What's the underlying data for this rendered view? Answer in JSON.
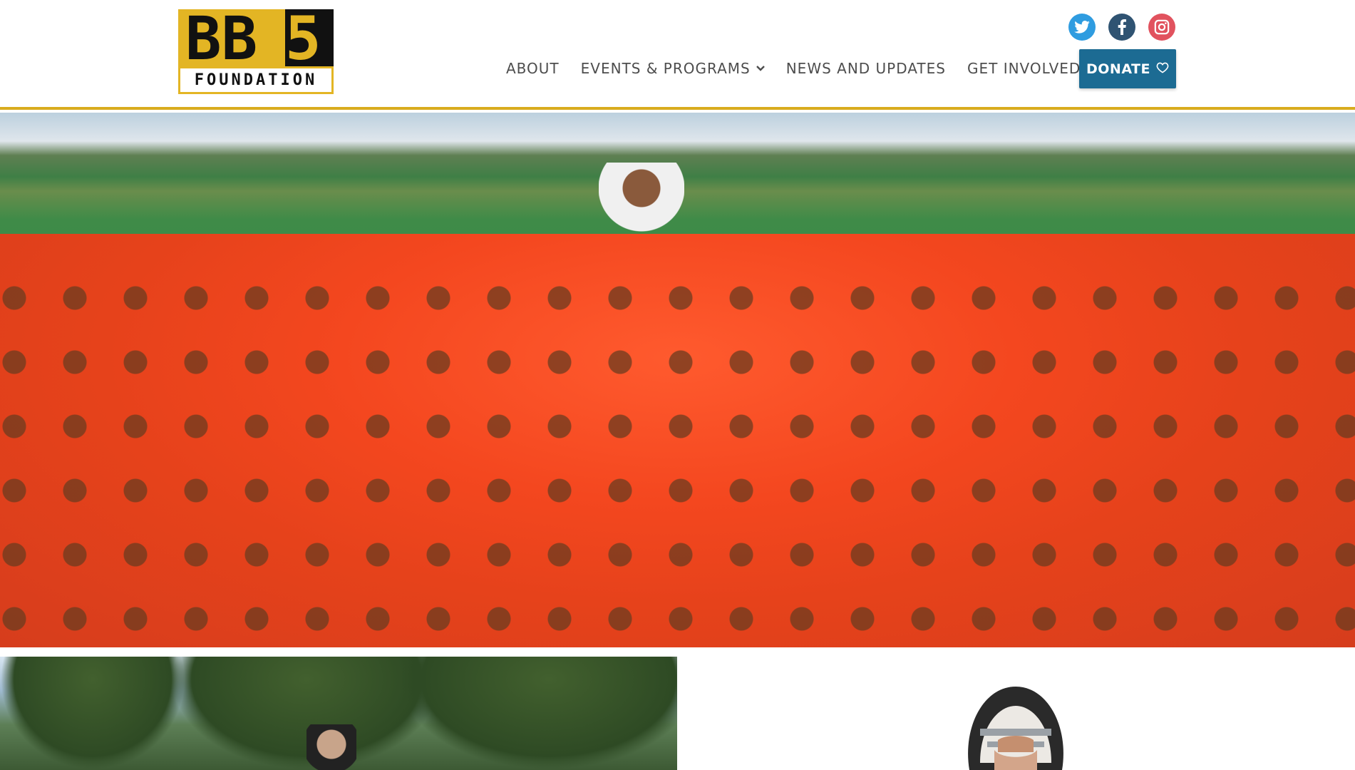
{
  "logo": {
    "mark_text": "BB5",
    "wordmark": "FOUNDATION",
    "colors": {
      "gold": "#e3b524",
      "black": "#111111"
    }
  },
  "social": [
    {
      "name": "twitter",
      "icon": "twitter-icon",
      "color": "#2f9ce0"
    },
    {
      "name": "facebook",
      "icon": "facebook-icon",
      "color": "#2f5372"
    },
    {
      "name": "instagram",
      "icon": "instagram-icon",
      "color": "#e1525e"
    }
  ],
  "nav": {
    "about": "ABOUT",
    "events": "EVENTS & PROGRAMS",
    "news": "NEWS AND UPDATES",
    "get_involved": "GET INVOLVED",
    "donate": "DONATE"
  },
  "colors": {
    "accent_gold": "#d9ac1e",
    "donate_blue": "#1c6b93",
    "nav_text": "#4d4d4d"
  }
}
